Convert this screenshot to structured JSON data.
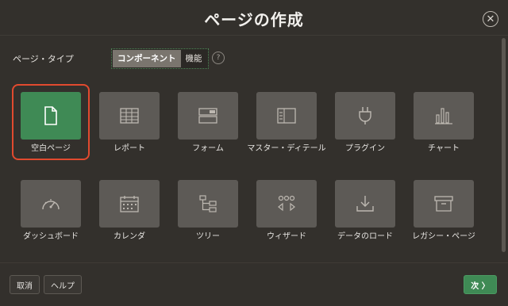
{
  "dialog": {
    "title": "ページの作成",
    "close_icon": "close-icon"
  },
  "page_type": {
    "label": "ページ・タイプ",
    "options": [
      "コンポーネント",
      "機能"
    ],
    "selected": "コンポーネント",
    "help": "?"
  },
  "tiles": [
    {
      "label": "空白ページ",
      "icon": "blank-page-icon",
      "selected": true
    },
    {
      "label": "レポート",
      "icon": "table-report-icon",
      "selected": false
    },
    {
      "label": "フォーム",
      "icon": "form-icon",
      "selected": false
    },
    {
      "label": "マスター・ディテール",
      "icon": "master-detail-icon",
      "selected": false
    },
    {
      "label": "プラグイン",
      "icon": "plugin-icon",
      "selected": false
    },
    {
      "label": "チャート",
      "icon": "chart-icon",
      "selected": false
    },
    {
      "label": "ダッシュボード",
      "icon": "dashboard-icon",
      "selected": false
    },
    {
      "label": "カレンダ",
      "icon": "calendar-icon",
      "selected": false
    },
    {
      "label": "ツリー",
      "icon": "tree-icon",
      "selected": false
    },
    {
      "label": "ウィザード",
      "icon": "wizard-icon",
      "selected": false
    },
    {
      "label": "データのロード",
      "icon": "data-load-icon",
      "selected": false
    },
    {
      "label": "レガシー・ページ",
      "icon": "legacy-page-icon",
      "selected": false
    }
  ],
  "footer": {
    "cancel": "取消",
    "help": "ヘルプ",
    "next": "次 〉"
  },
  "colors": {
    "accent": "#3f8a55",
    "highlight_ring": "#e24a2f",
    "tile": "#5d5a56",
    "background": "#33302c"
  }
}
